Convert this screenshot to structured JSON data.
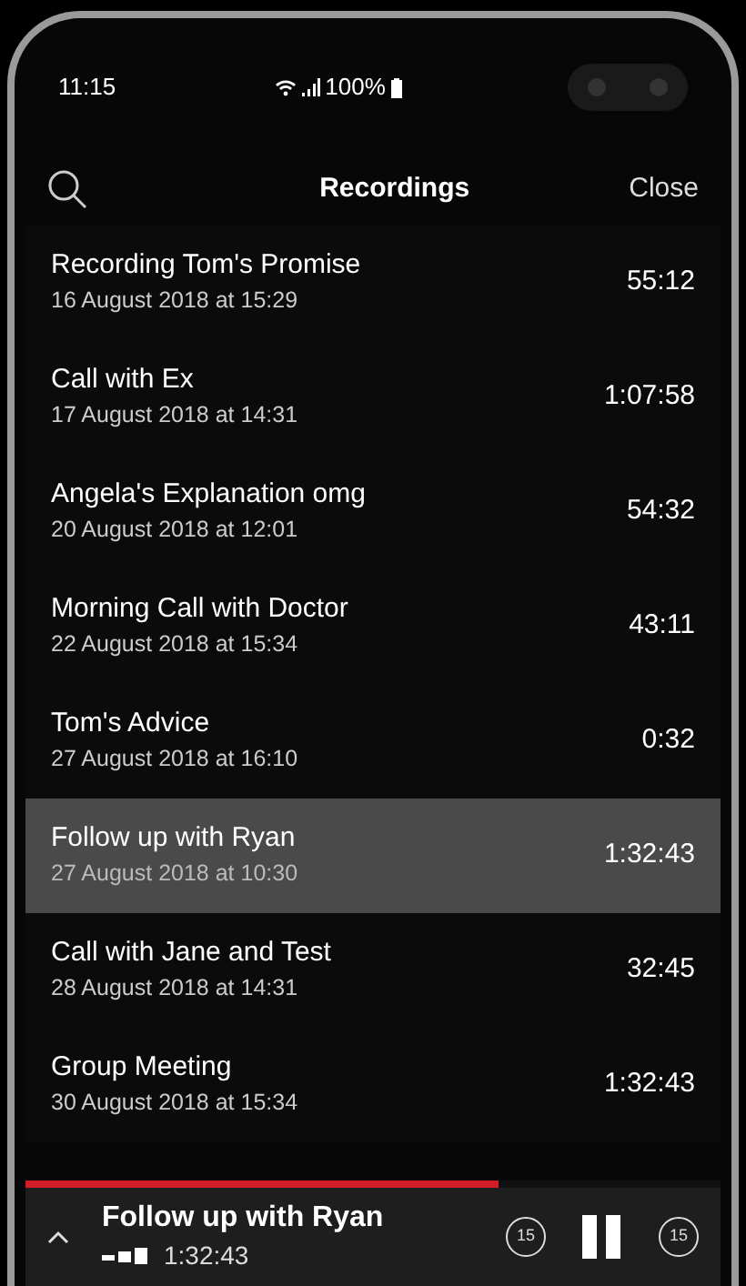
{
  "status_bar": {
    "time": "11:15",
    "battery": "100%"
  },
  "header": {
    "title": "Recordings",
    "close": "Close"
  },
  "recordings": [
    {
      "title": "Recording Tom's Promise",
      "date": "16 August 2018 at 15:29",
      "duration": "55:12",
      "selected": false
    },
    {
      "title": "Call with Ex",
      "date": "17 August 2018 at 14:31",
      "duration": "1:07:58",
      "selected": false
    },
    {
      "title": "Angela's Explanation omg",
      "date": "20 August 2018 at 12:01",
      "duration": "54:32",
      "selected": false
    },
    {
      "title": "Morning Call with Doctor",
      "date": "22 August 2018 at 15:34",
      "duration": "43:11",
      "selected": false
    },
    {
      "title": "Tom's Advice",
      "date": "27 August 2018 at 16:10",
      "duration": "0:32",
      "selected": false
    },
    {
      "title": "Follow up with Ryan",
      "date": "27 August 2018 at 10:30",
      "duration": "1:32:43",
      "selected": true
    },
    {
      "title": "Call with Jane and Test",
      "date": "28 August 2018 at 14:31",
      "duration": "32:45",
      "selected": false
    },
    {
      "title": "Group Meeting",
      "date": "30 August 2018 at 15:34",
      "duration": "1:32:43",
      "selected": false
    }
  ],
  "player": {
    "title": "Follow up with Ryan",
    "time": "1:32:43",
    "level": 0.68,
    "back_seconds": "15",
    "forward_seconds": "15"
  }
}
